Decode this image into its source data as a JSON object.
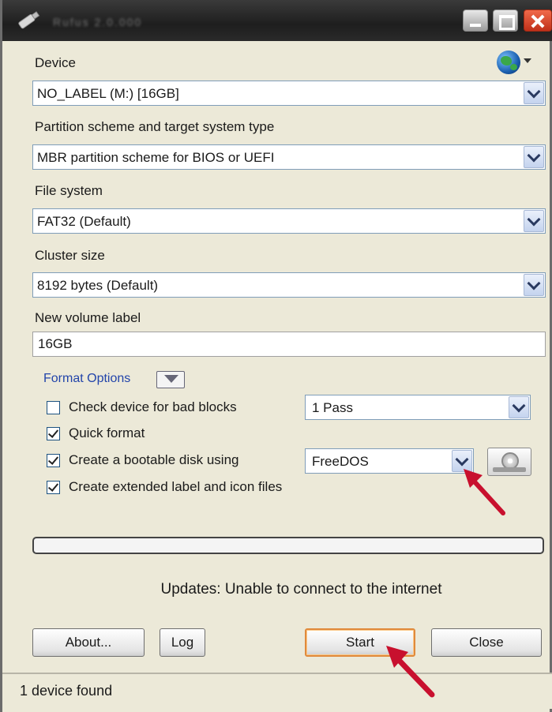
{
  "window": {
    "title": "Rufus 2.0.000",
    "controls": {
      "minimize": "minimize",
      "maximize": "maximize",
      "close": "close"
    }
  },
  "device": {
    "label": "Device",
    "value": "NO_LABEL (M:) [16GB]"
  },
  "partition": {
    "label": "Partition scheme and target system type",
    "value": "MBR partition scheme for BIOS or UEFI"
  },
  "filesystem": {
    "label": "File system",
    "value": "FAT32 (Default)"
  },
  "cluster": {
    "label": "Cluster size",
    "value": "8192 bytes (Default)"
  },
  "volume": {
    "label": "New volume label",
    "value": "16GB"
  },
  "format_options": {
    "title": "Format Options",
    "check_bad_blocks": {
      "label": "Check device for bad blocks",
      "checked": false,
      "passes": "1 Pass"
    },
    "quick_format": {
      "label": "Quick format",
      "checked": true
    },
    "bootable": {
      "label": "Create a bootable disk using",
      "checked": true,
      "value": "FreeDOS"
    },
    "extended_label": {
      "label": "Create extended label and icon files",
      "checked": true
    }
  },
  "progress": {
    "value": 0
  },
  "status_message": "Updates: Unable to connect to the internet",
  "buttons": {
    "about": "About...",
    "log": "Log",
    "start": "Start",
    "close": "Close"
  },
  "statusbar": {
    "text": "1 device found"
  },
  "icons": [
    "globe-icon",
    "usb-drive-icon",
    "disc-image-icon",
    "dropdown-arrow-icon",
    "format-options-toggle-icon"
  ],
  "colors": {
    "accent_link": "#2244aa",
    "default_button_border": "#e08a3c",
    "window_bg": "#ece9d8",
    "annotation_arrow": "#c8102e"
  }
}
